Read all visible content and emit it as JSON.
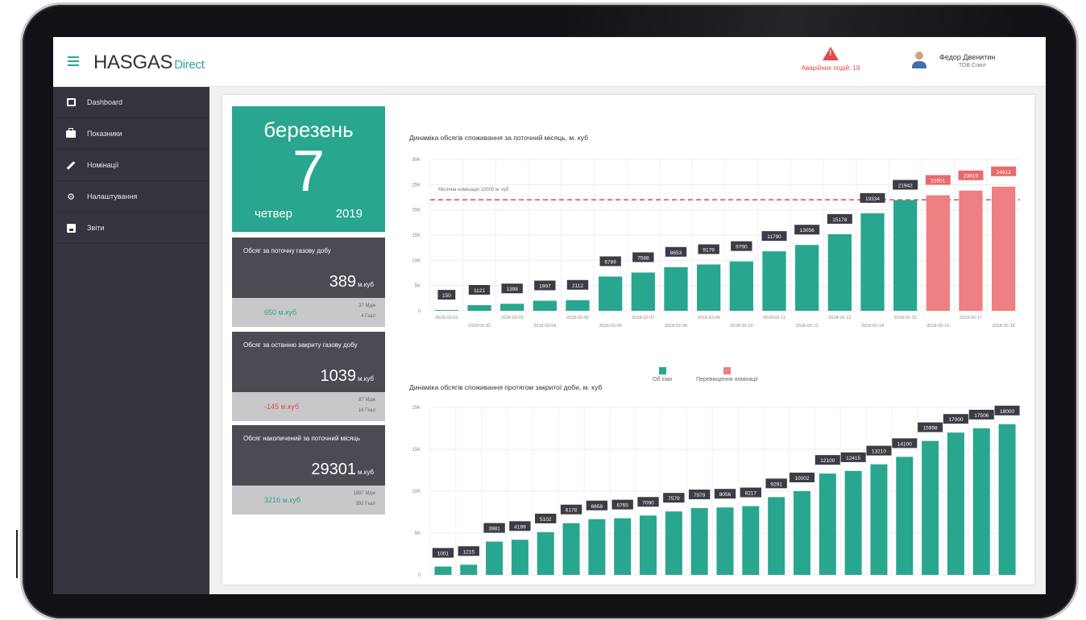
{
  "app": {
    "logo_main": "HASGAS",
    "logo_sub": "Direct",
    "alert_text": "Аварійних подій: 18",
    "user_name": "Федор Двенитин",
    "user_org": "ТОВ Сокіл"
  },
  "colors": {
    "accent": "#29a68f",
    "exceed": "#ee7f82",
    "sidebar": "#33343d",
    "alert": "#e24b4b"
  },
  "sidebar": {
    "items": [
      {
        "label": "Dashboard",
        "icon": "chart-icon"
      },
      {
        "label": "Показники",
        "icon": "briefcase-icon"
      },
      {
        "label": "Номінації",
        "icon": "pencil-icon"
      },
      {
        "label": "Налаштування",
        "icon": "gear-icon"
      },
      {
        "label": "Звіти",
        "icon": "save-icon"
      }
    ]
  },
  "date_card": {
    "month": "березень",
    "day": "7",
    "weekday": "четвер",
    "year": "2019"
  },
  "stats": [
    {
      "title": "Обсяг за поточну газову добу",
      "value": "389",
      "unit": "м.куб",
      "diff": "650 м.куб",
      "mj": "37 Мдж",
      "gcal": "4 Гкал"
    },
    {
      "title": "Обсяг за останню закриту газову добу",
      "value": "1039",
      "unit": "м.куб",
      "diff": "-145 м.куб",
      "mj": "87 Мдж",
      "gcal": "16 Гкал"
    },
    {
      "title": "Обсяг накопичений за поточний місяць",
      "value": "29301",
      "unit": "м.куб",
      "diff": "3216 м.куб",
      "mj": "1897 Мдж",
      "gcal": "392 Гкал"
    }
  ],
  "chart_data": [
    {
      "type": "bar",
      "title": "Динаміка обсягів споживання за поточний місяць, м. куб",
      "ylim": [
        0,
        30000
      ],
      "yticks": [
        "0",
        "5K",
        "10K",
        "15K",
        "20K",
        "25K",
        "30K"
      ],
      "reference_line": {
        "value": 22000,
        "label": "Місячна номінація 22000 м. куб"
      },
      "categories": [
        "2018-02-01",
        "2018-02-02",
        "2018-02-03",
        "2018-02-04",
        "2018-02-05",
        "2018-02-06",
        "2018-02-07",
        "2018-02-08",
        "2018-02-09",
        "2018-02-10",
        "2018-02-11",
        "2018-02-12",
        "2018-02-13",
        "2018-02-14",
        "2018-02-15",
        "2018-02-16",
        "2018-02-17",
        "2018-02-18"
      ],
      "series": [
        {
          "name": "Об`єми",
          "values": [
            150,
            1121,
            1398,
            1997,
            2112,
            6789,
            7588,
            8653,
            9179,
            9790,
            11790,
            13056,
            15178,
            19334,
            21942,
            null,
            null,
            null
          ]
        },
        {
          "name": "Перевищення номінації",
          "values": [
            null,
            null,
            null,
            null,
            null,
            null,
            null,
            null,
            null,
            null,
            null,
            null,
            null,
            null,
            null,
            22901,
            23819,
            24612
          ]
        }
      ],
      "legend": "bottom"
    },
    {
      "type": "bar",
      "title": "Динаміка обсягів споживання протягом закритої доби, м. куб",
      "ylim": [
        0,
        20000
      ],
      "yticks": [
        "0",
        "5K",
        "10K",
        "15K",
        "20K"
      ],
      "values": [
        1001,
        1215,
        3981,
        4199,
        5102,
        6178,
        6658,
        6765,
        7090,
        7579,
        7979,
        8056,
        8217,
        9291,
        10002,
        12100,
        12415,
        13210,
        14100,
        15998,
        17000,
        17506,
        18000
      ]
    }
  ]
}
